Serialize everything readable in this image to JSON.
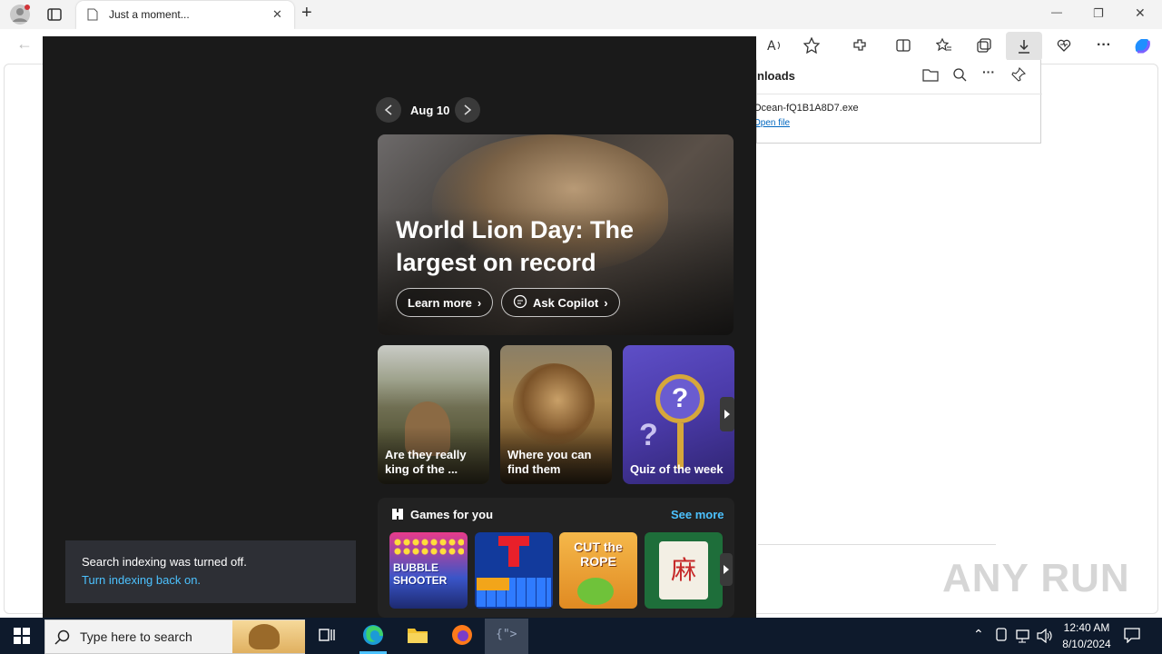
{
  "browser": {
    "tab_title": "Just a moment...",
    "new_tab_glyph": "+",
    "window_controls": {
      "minimize": "—",
      "restore": "❐",
      "close": "✕"
    }
  },
  "downloads": {
    "title": "nloads",
    "file_name": "Ocean-fQ1B1A8D7.exe",
    "open_link": "Open file"
  },
  "start_panel": {
    "date_label": "Aug 10",
    "hero": {
      "title_line1": "World Lion Day: The",
      "title_line2": "largest on record",
      "learn_more": "Learn more",
      "ask_copilot": "Ask Copilot"
    },
    "cards": [
      {
        "label_line1": "Are they really",
        "label_line2": "king of the ..."
      },
      {
        "label_line1": "Where you can",
        "label_line2": "find them"
      },
      {
        "label_line1": "Quiz of the week",
        "label_line2": ""
      }
    ],
    "games": {
      "title": "Games for you",
      "see_more": "See more",
      "items": [
        "BUBBLE SHOOTER",
        "",
        "CUT the ROPE",
        "麻"
      ]
    }
  },
  "notification": {
    "line1": "Search indexing was turned off.",
    "line2": "Turn indexing back on."
  },
  "taskbar": {
    "search_placeholder": "Type here to search",
    "time": "12:40 AM",
    "date": "8/10/2024"
  },
  "watermark": "ANY RUN",
  "colors": {
    "accent": "#4cc2ff",
    "taskbar": "#0e1a2c",
    "panel_bg": "#1a1a1a"
  }
}
